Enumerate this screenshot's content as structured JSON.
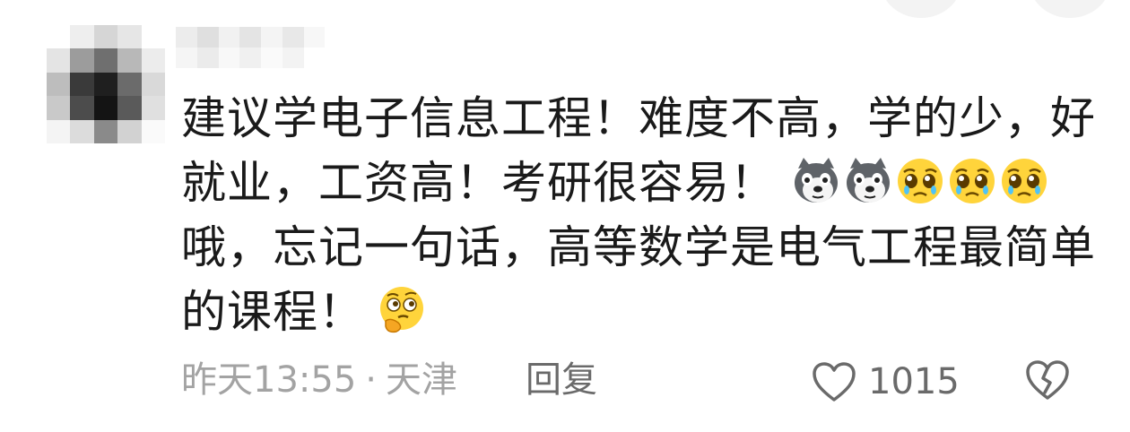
{
  "comment": {
    "lines": [
      "建议学电子信息工程！难度不高，学的少，好",
      "就业，工资高！考研很容易！",
      "哦，忘记一句话，高等数学是电气工程最简单",
      "的课程！"
    ],
    "inline_emojis_line2": [
      "dog-face",
      "dog-face",
      "pleading-face",
      "pleading-face",
      "pleading-face"
    ],
    "inline_emojis_line4": [
      "thinking-face"
    ]
  },
  "meta": {
    "time": "昨天13:55",
    "separator": "·",
    "location": "天津",
    "reply_label": "回复"
  },
  "like": {
    "count": "1015",
    "icon": "heart-outline-icon"
  },
  "dislike": {
    "icon": "broken-heart-icon"
  },
  "colors": {
    "text": "#1a1a1a",
    "meta_text": "#a3a3a3",
    "action_text": "#6a6a6a"
  }
}
